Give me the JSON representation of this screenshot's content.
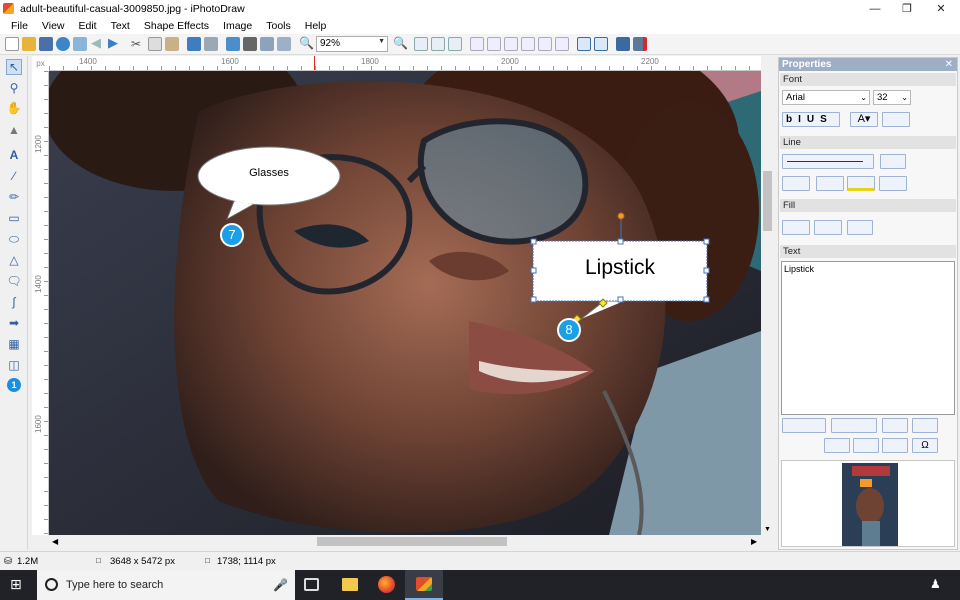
{
  "window": {
    "title": "adult-beautiful-casual-3009850.jpg - iPhotoDraw"
  },
  "menu": [
    "File",
    "View",
    "Edit",
    "Text",
    "Shape Effects",
    "Image",
    "Tools",
    "Help"
  ],
  "toolbar": {
    "zoom": "92%"
  },
  "ruler": {
    "unit": "px",
    "h_ticks": [
      "1400",
      "1600",
      "1800",
      "2000",
      "2200"
    ],
    "v_ticks": [
      "1200",
      "1400",
      "1600"
    ]
  },
  "callouts": [
    {
      "text": "Glasses",
      "marker": "7"
    },
    {
      "text": "Lipstick",
      "marker": "8"
    }
  ],
  "properties": {
    "title": "Properties",
    "font_section": "Font",
    "font_name": "Arial",
    "font_size": "32",
    "line_section": "Line",
    "fill_section": "Fill",
    "text_section": "Text",
    "text_value": "Lipstick"
  },
  "status": {
    "file_size": "1.2M",
    "dimensions": "3648 x 5472 px",
    "cursor": "1738; 1114 px"
  },
  "taskbar": {
    "search_placeholder": "Type here to search"
  },
  "colors": {
    "marker": "#1aa0e6",
    "props_header": "#9eaec4",
    "taskbar": "#202228"
  }
}
